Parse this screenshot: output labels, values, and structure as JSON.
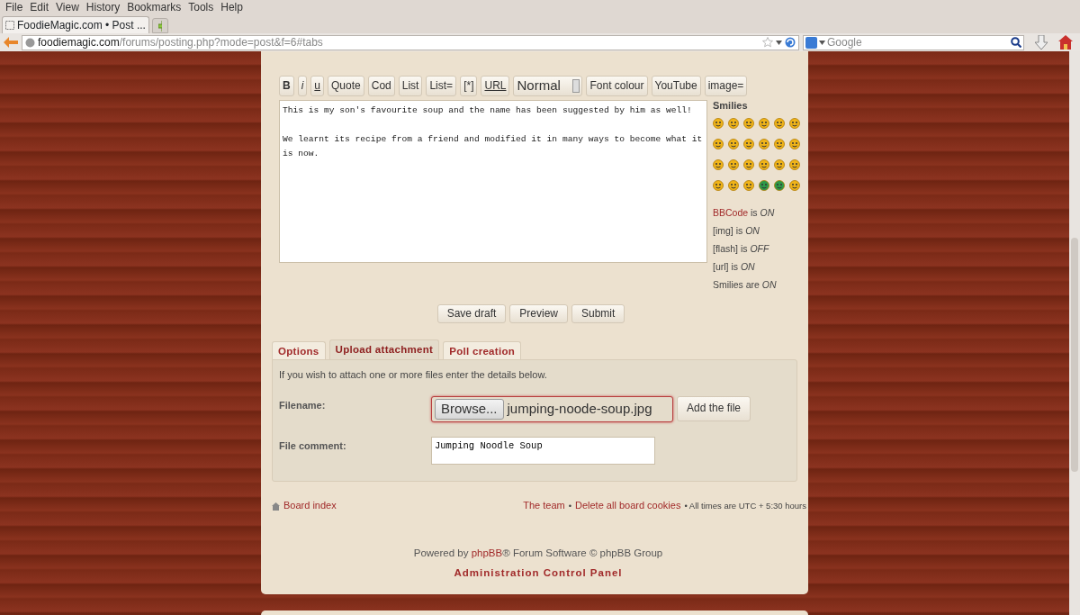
{
  "browser": {
    "menus": [
      "File",
      "Edit",
      "View",
      "History",
      "Bookmarks",
      "Tools",
      "Help"
    ],
    "tab_title": "FoodieMagic.com • Post ...",
    "url_host": "foodiemagic.com",
    "url_path": "/forums/posting.php?mode=post&f=6#tabs",
    "search": {
      "placeholder": "Google"
    }
  },
  "editor": {
    "format_buttons": [
      {
        "label": "B",
        "kind": "bold"
      },
      {
        "label": "i",
        "kind": "italic"
      },
      {
        "label": "u",
        "kind": "underline"
      },
      {
        "label": "Quote",
        "kind": "plain"
      },
      {
        "label": "Cod",
        "kind": "plain"
      },
      {
        "label": "List",
        "kind": "plain"
      },
      {
        "label": "List=",
        "kind": "plain"
      },
      {
        "label": "[*]",
        "kind": "plain"
      },
      {
        "label": "URL",
        "kind": "underline"
      },
      {
        "label": "Normal",
        "kind": "select"
      },
      {
        "label": "Font colour",
        "kind": "plain"
      },
      {
        "label": "YouTube",
        "kind": "plain"
      },
      {
        "label": "image=",
        "kind": "plain"
      }
    ],
    "message": "This is my son's favourite soup and the name has been suggested by him as well!\n\nWe learnt its recipe from a friend and modified it in many ways to become what it is now.",
    "smilies_title": "Smilies",
    "status": [
      {
        "link": "BBCode",
        "text": "is *ON*"
      },
      {
        "text": "[img] is *ON*"
      },
      {
        "text": "[flash] is *OFF*"
      },
      {
        "text": "[url] is *ON*"
      },
      {
        "text": "Smilies are *ON*"
      }
    ],
    "actions": [
      "Save draft",
      "Preview",
      "Submit"
    ]
  },
  "tabs": [
    {
      "label": "Options",
      "selected": false
    },
    {
      "label": "Upload attachment",
      "selected": true
    },
    {
      "label": "Poll creation",
      "selected": false
    }
  ],
  "attachment": {
    "intro": "If you wish to attach one or more files enter the details below.",
    "filename_label": "Filename:",
    "browse": "Browse...",
    "file": "jumping-noode-soup.jpg",
    "add": "Add the file",
    "comment_label": "File comment:",
    "comment": "Jumping Noodle Soup"
  },
  "footer": {
    "board_index": "Board index",
    "links": [
      "The team",
      "Delete all board cookies"
    ],
    "separator": "•",
    "timezone": "• All times are UTC + 5:30 hours",
    "powered_prefix": "Powered by ",
    "powered_link": "phpBB",
    "powered_suffix": "® Forum Software © phpBB Group",
    "acp": "Administration Control Panel"
  }
}
